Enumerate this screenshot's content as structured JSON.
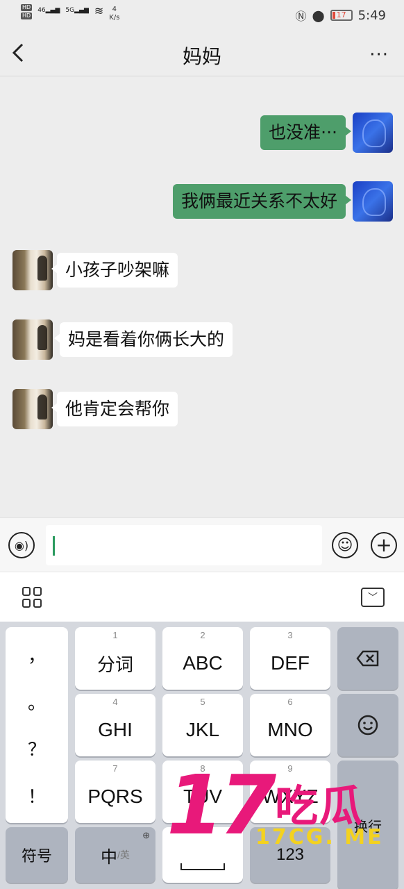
{
  "status_bar": {
    "hd1": "HD",
    "hd2": "HD",
    "signal1": "46",
    "signal2": "5G",
    "speed_value": "4",
    "speed_unit": "K/s",
    "battery_level": "17",
    "battery_fraction": 0.17,
    "time": "5:49"
  },
  "header": {
    "title": "妈妈",
    "back_icon": "chevron-left-icon",
    "more_label": "···"
  },
  "messages": [
    {
      "sender": "me",
      "text": "也没准···"
    },
    {
      "sender": "me",
      "text": "我俩最近关系不太好"
    },
    {
      "sender": "mom",
      "text": "小孩子吵架嘛"
    },
    {
      "sender": "mom",
      "text": "妈是看着你俩长大的"
    },
    {
      "sender": "mom",
      "text": "他肯定会帮你"
    }
  ],
  "input_bar": {
    "voice_icon": "voice-icon",
    "emoji_icon": "emoji-icon",
    "plus_icon": "plus-icon",
    "value": ""
  },
  "keyboard": {
    "punctuation": [
      "，",
      "。",
      "？",
      "！"
    ],
    "keys": [
      {
        "num": "1",
        "label": "分词"
      },
      {
        "num": "2",
        "label": "ABC"
      },
      {
        "num": "3",
        "label": "DEF"
      },
      {
        "num": "4",
        "label": "GHI"
      },
      {
        "num": "5",
        "label": "JKL"
      },
      {
        "num": "6",
        "label": "MNO"
      },
      {
        "num": "7",
        "label": "PQRS"
      },
      {
        "num": "8",
        "label": "TUV"
      },
      {
        "num": "9",
        "label": "WXYZ"
      }
    ],
    "symbols_label": "符号",
    "lang_label_main": "中",
    "lang_label_sub": "/英",
    "numbers_label": "123",
    "enter_label": "换行",
    "delete_icon": "backspace-icon",
    "emoji_icon": "smiley-icon",
    "globe_icon": "globe-icon"
  },
  "watermark": {
    "number": "17",
    "chinese": "吃瓜",
    "domain": "17CG. ME"
  },
  "colors": {
    "outgoing_bubble": "#4e9e6b",
    "incoming_bubble": "#ffffff",
    "background": "#ededed",
    "watermark_pink": "#e8197a",
    "watermark_yellow": "#f4d21e"
  }
}
